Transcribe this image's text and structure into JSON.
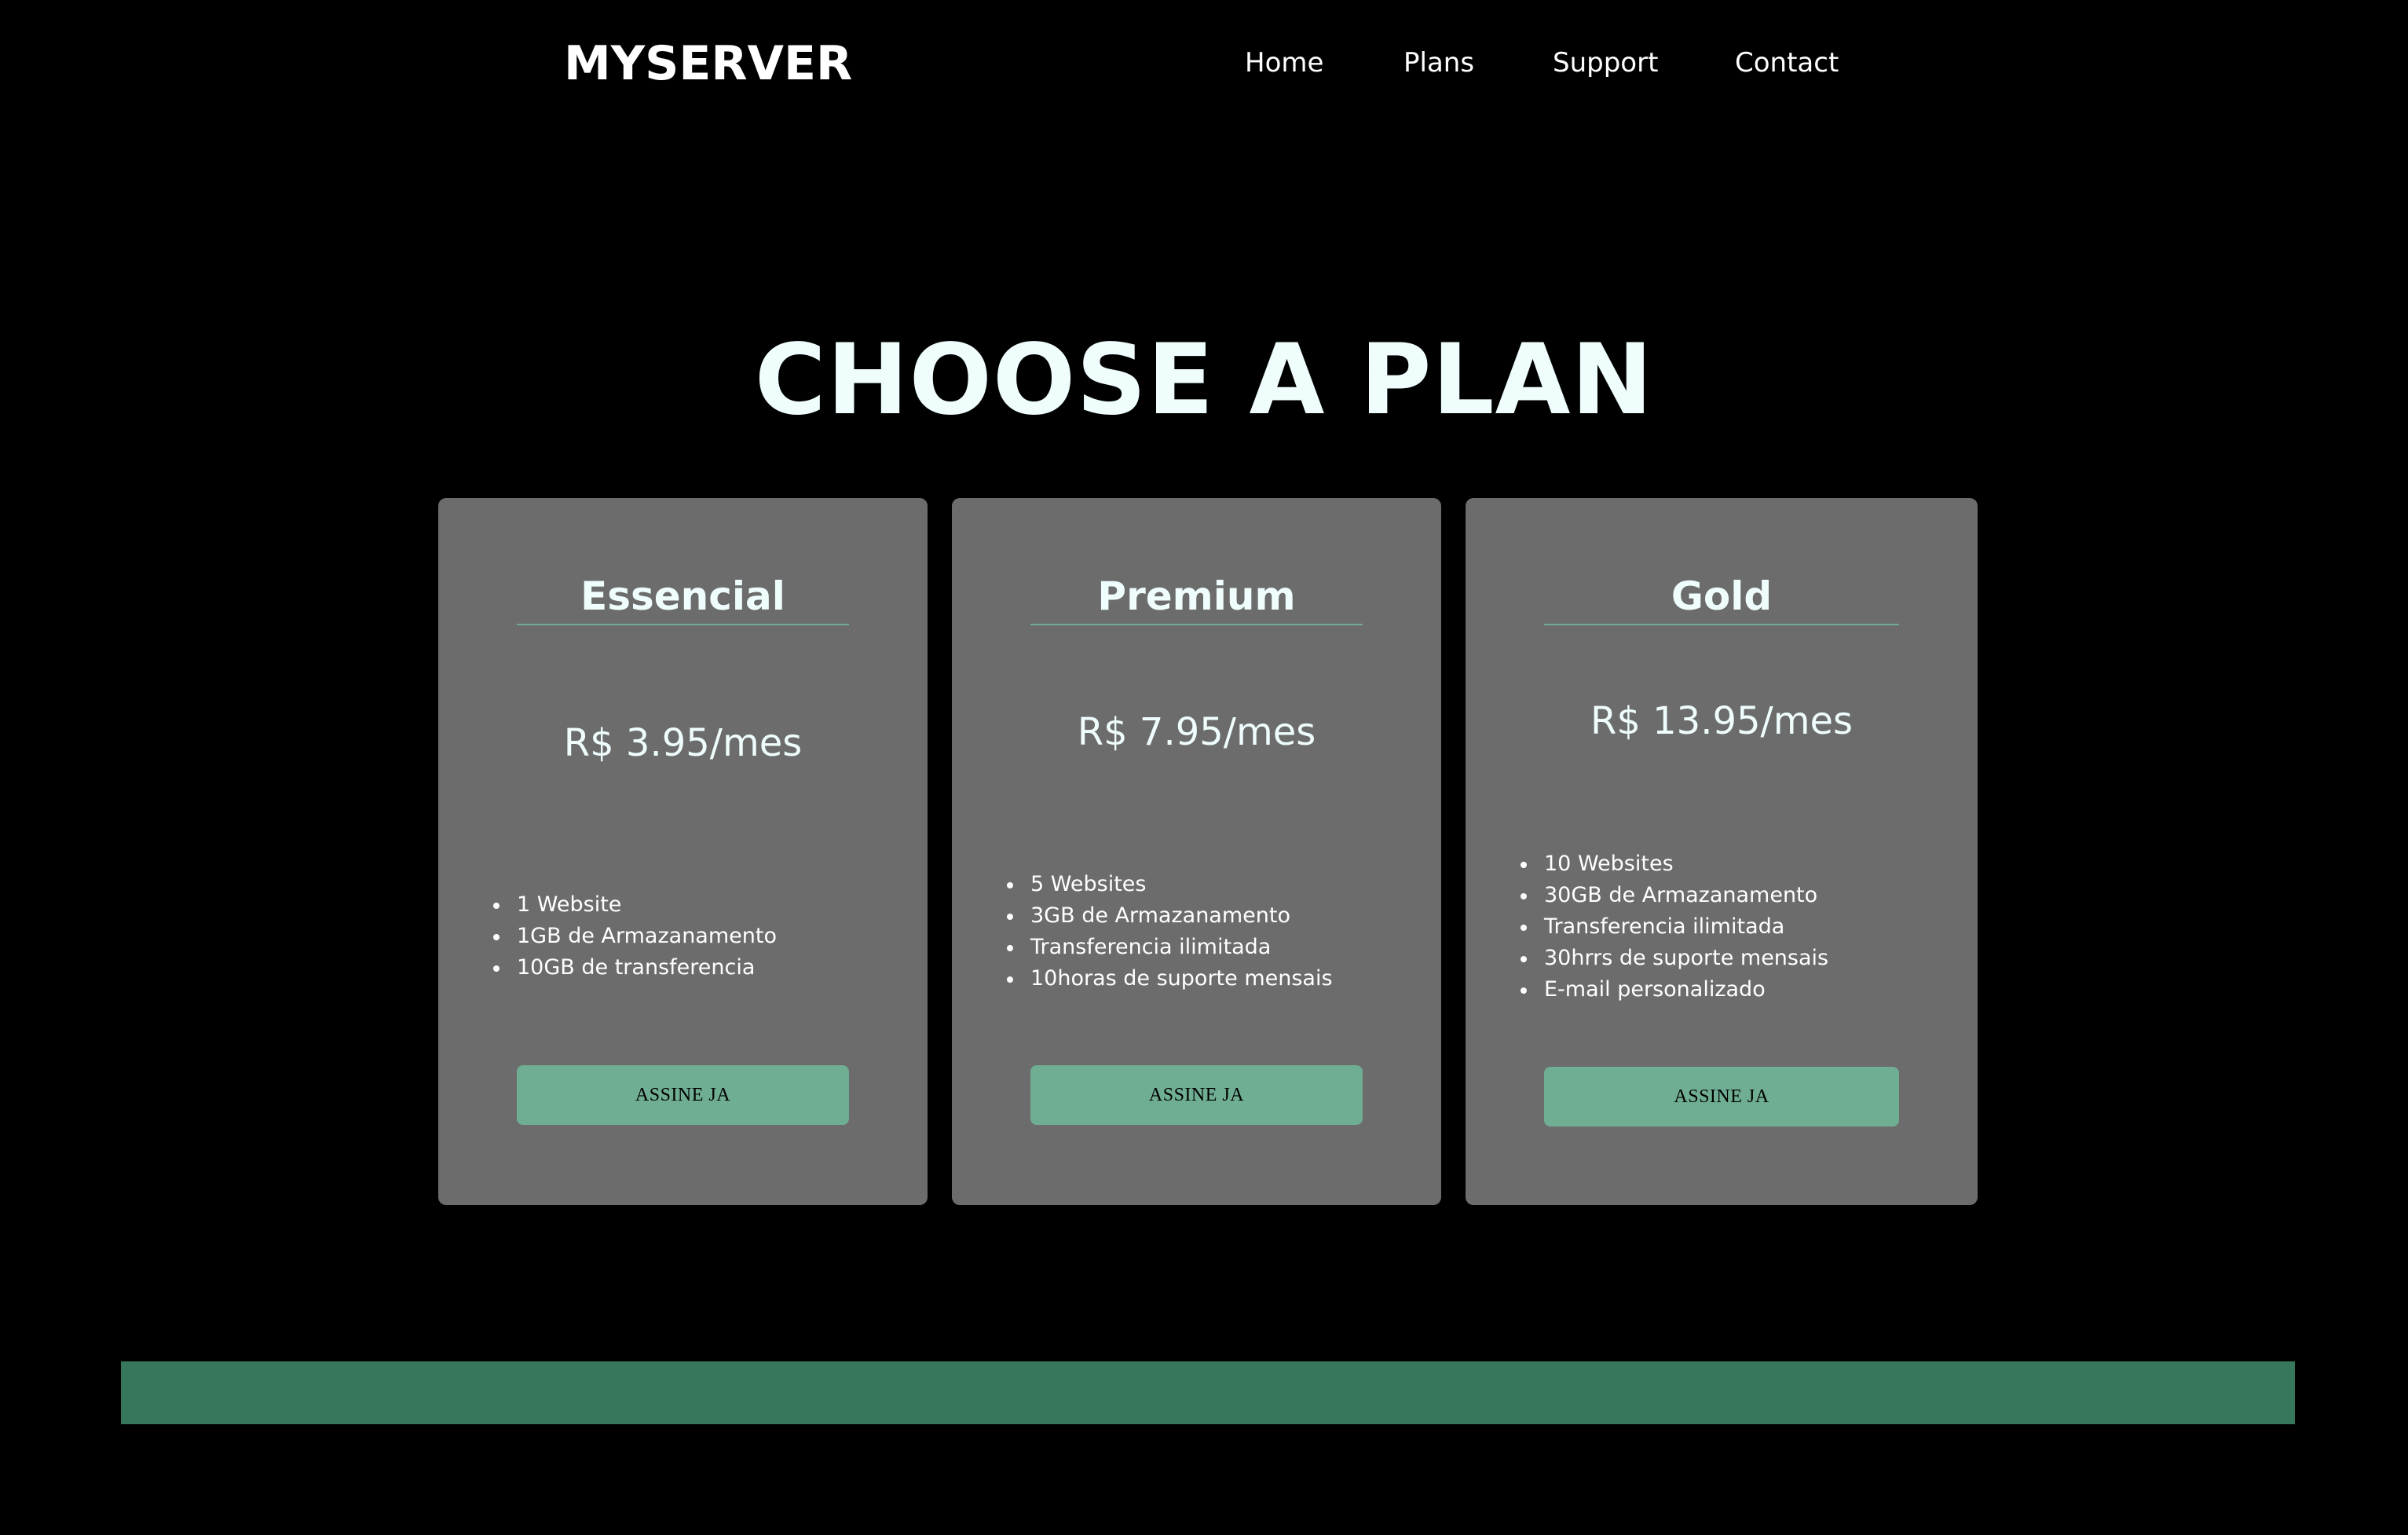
{
  "header": {
    "brand": "MYSERVER",
    "nav": [
      {
        "label": "Home"
      },
      {
        "label": "Plans"
      },
      {
        "label": "Support"
      },
      {
        "label": "Contact"
      }
    ]
  },
  "main": {
    "title": "CHOOSE A PLAN",
    "plans": [
      {
        "name": "Essencial",
        "price": "R$ 3.95/mes",
        "features": [
          "1 Website",
          "1GB de Armazanamento",
          "10GB de transferencia"
        ],
        "cta": "ASSINE JA"
      },
      {
        "name": "Premium",
        "price": "R$ 7.95/mes",
        "features": [
          "5 Websites",
          "3GB de Armazanamento",
          "Transferencia ilimitada",
          "10horas de suporte mensais"
        ],
        "cta": "ASSINE JA"
      },
      {
        "name": "Gold",
        "price": "R$ 13.95/mes",
        "features": [
          "10 Websites",
          "30GB de Armazanamento",
          "Transferencia ilimitada",
          "30hrrs de suporte mensais",
          "E-mail personalizado"
        ],
        "cta": "ASSINE JA"
      }
    ]
  },
  "colors": {
    "background": "#000000",
    "card": "#6c6c6c",
    "accent": "#6fae93",
    "footer": "#37775b",
    "title_text": "#effdfd"
  }
}
